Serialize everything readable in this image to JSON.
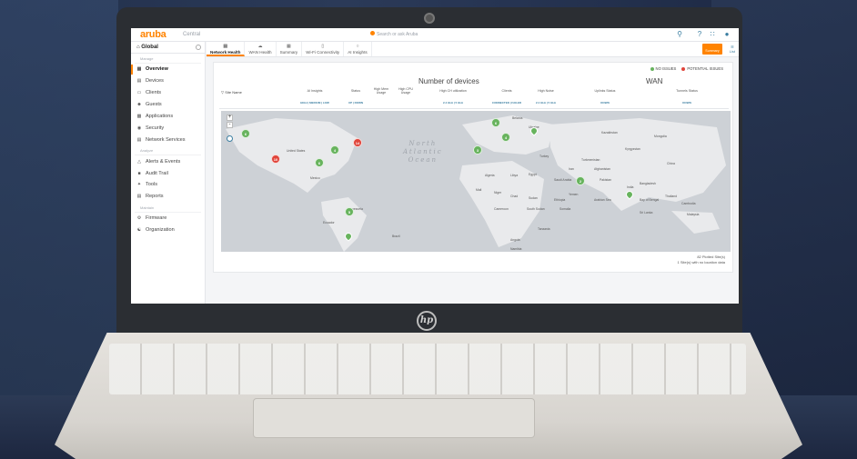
{
  "app": {
    "brand": "aruba",
    "product": "Central",
    "search_placeholder": "Search or ask Aruba"
  },
  "sidebar": {
    "scope": "Global",
    "sections": {
      "manage": "Manage",
      "analyze": "Analyze",
      "maintain": "Maintain"
    },
    "manage_items": [
      {
        "label": "Overview",
        "icon": "grid-icon",
        "active": true
      },
      {
        "label": "Devices",
        "icon": "devices-icon"
      },
      {
        "label": "Clients",
        "icon": "laptop-icon"
      },
      {
        "label": "Guests",
        "icon": "guests-icon"
      },
      {
        "label": "Applications",
        "icon": "apps-icon"
      },
      {
        "label": "Security",
        "icon": "shield-icon"
      },
      {
        "label": "Network Services",
        "icon": "network-icon"
      }
    ],
    "analyze_items": [
      {
        "label": "Alerts & Events",
        "icon": "bell-icon"
      },
      {
        "label": "Audit Trail",
        "icon": "audit-icon"
      },
      {
        "label": "Tools",
        "icon": "wrench-icon"
      },
      {
        "label": "Reports",
        "icon": "report-icon"
      }
    ],
    "maintain_items": [
      {
        "label": "Firmware",
        "icon": "firmware-icon"
      },
      {
        "label": "Organization",
        "icon": "org-icon"
      }
    ]
  },
  "tabs": [
    {
      "label": "Network Health",
      "active": true
    },
    {
      "label": "WAN Health"
    },
    {
      "label": "Summary"
    },
    {
      "label": "Wi-Fi Connectivity"
    },
    {
      "label": "AI Insights"
    }
  ],
  "toolbar": {
    "summary_label": "Summary",
    "list_label": "List"
  },
  "panel": {
    "legend_no_issues": "NO ISSUES",
    "legend_potential": "POTENTIAL ISSUES",
    "section_devices": "Number of devices",
    "section_wan": "WAN",
    "site_filter": "Site Name",
    "columns": {
      "ai_insights": "AI Insights",
      "ai_high": "HIGH",
      "ai_medium": "MEDIUM",
      "ai_low": "LOW",
      "status": "Status",
      "status_up": "UP",
      "status_down": "DOWN",
      "high_mem": "High Mem Usage",
      "high_cpu": "High CPU Usage",
      "high_ch": "High CH utilization",
      "ch_sub": "2.4 GHz | 5 GHz",
      "clients": "Clients",
      "clients_sub": "CONNECTED | FAILED",
      "high_noise": "High Noise",
      "noise_sub": "2.4 GHz | 5 GHz",
      "uplinks": "Uplinks Status",
      "uplinks_sub": "DOWN",
      "tunnels": "Tunnels Status",
      "tunnels_sub": "DOWN"
    },
    "map": {
      "ocean_1": "North",
      "ocean_2": "Atlantic",
      "ocean_3": "Ocean",
      "labels": [
        "United States",
        "Mexico",
        "Venezuela",
        "Ecuador",
        "Brazil",
        "Algeria",
        "Libya",
        "Egypt",
        "Mali",
        "Niger",
        "Chad",
        "Sudan",
        "Ethiopia",
        "Cameroon",
        "Angola",
        "Tanzania",
        "Turkey",
        "Iran",
        "Kazakhstan",
        "Mongolia",
        "China",
        "India",
        "Pakistan",
        "Turkmenistan",
        "Afghanistan",
        "Bangladesh",
        "Thailand",
        "Cambodia",
        "Sri Lanka",
        "Saudi Arabia",
        "Yemen",
        "Ukraine",
        "Belarus",
        "Kyrgyzstan",
        "Malaysia",
        "Bay of Bengal",
        "Arabian Sea",
        "South Sudan",
        "Namibia",
        "Somalia"
      ],
      "markers": [
        {
          "value": "6",
          "color": "green"
        },
        {
          "value": "4",
          "color": "green"
        },
        {
          "value": "14",
          "color": "red"
        },
        {
          "value": "10",
          "color": "red"
        },
        {
          "value": "6",
          "color": "green"
        },
        {
          "value": "5",
          "color": "green"
        },
        {
          "value": "3",
          "color": "green"
        },
        {
          "value": "6",
          "color": "green"
        },
        {
          "value": "4",
          "color": "green"
        },
        {
          "value": "2",
          "color": "green"
        }
      ]
    },
    "plotted_count": "82 Plotted Site(s)",
    "no_location": "1 Site(s) with no location data"
  }
}
